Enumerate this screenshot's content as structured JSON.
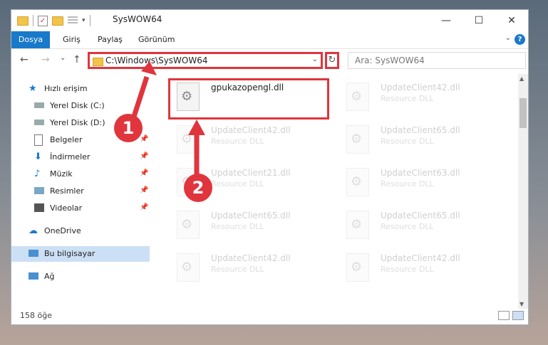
{
  "window": {
    "title": "SysWOW64"
  },
  "window_controls": {
    "minimize": "—",
    "maximize": "☐",
    "close": "✕"
  },
  "ribbon": {
    "file_tab": "Dosya",
    "tabs": [
      "Giriş",
      "Paylaş",
      "Görünüm"
    ],
    "help": "?"
  },
  "nav": {
    "back": "←",
    "forward": "→",
    "recent": "⌄",
    "up": "↑",
    "address_path": "C:\\Windows\\SysWOW64",
    "refresh": "↻",
    "search_placeholder": "Ara: SysWOW64"
  },
  "sidebar": {
    "items": [
      {
        "label": "Hızlı erişim",
        "icon": "star-icon",
        "pinned": false
      },
      {
        "label": "Yerel Disk (C:)",
        "icon": "drive-icon",
        "pinned": false
      },
      {
        "label": "Yerel Disk (D:)",
        "icon": "drive-icon",
        "pinned": false
      },
      {
        "label": "Belgeler",
        "icon": "document-icon",
        "pinned": true
      },
      {
        "label": "İndirmeler",
        "icon": "download-icon",
        "pinned": true
      },
      {
        "label": "Müzik",
        "icon": "music-icon",
        "pinned": true
      },
      {
        "label": "Resimler",
        "icon": "picture-icon",
        "pinned": true
      },
      {
        "label": "Videolar",
        "icon": "video-icon",
        "pinned": true
      },
      {
        "label": "OneDrive",
        "icon": "cloud-icon",
        "pinned": false
      },
      {
        "label": "Bu bilgisayar",
        "icon": "computer-icon",
        "pinned": false
      },
      {
        "label": "Ağ",
        "icon": "network-icon",
        "pinned": false
      }
    ]
  },
  "files": [
    {
      "name": "gpukazopengl.dll",
      "type": ""
    },
    {
      "name": "UpdateClient42.dll",
      "type": "Resource DLL"
    },
    {
      "name": "UpdateClient42.dll",
      "type": "Resource DLL"
    },
    {
      "name": "UpdateClient65.dll",
      "type": "Resource DLL"
    },
    {
      "name": "UpdateClient21.dll",
      "type": "Resource DLL"
    },
    {
      "name": "UpdateClient63.dll",
      "type": "Resource DLL"
    },
    {
      "name": "UpdateClient65.dll",
      "type": "Resource DLL"
    },
    {
      "name": "UpdateClient65.dll",
      "type": "Resource DLL"
    },
    {
      "name": "UpdateClient42.dll",
      "type": "Resource DLL"
    },
    {
      "name": "UpdateClient42.dll",
      "type": "Resource DLL"
    }
  ],
  "status": {
    "item_count": "158 öğe"
  },
  "callouts": {
    "one": "1",
    "two": "2"
  },
  "colors": {
    "accent": "#1979ca",
    "highlight": "#e0353d",
    "selected": "#cce0f5"
  }
}
